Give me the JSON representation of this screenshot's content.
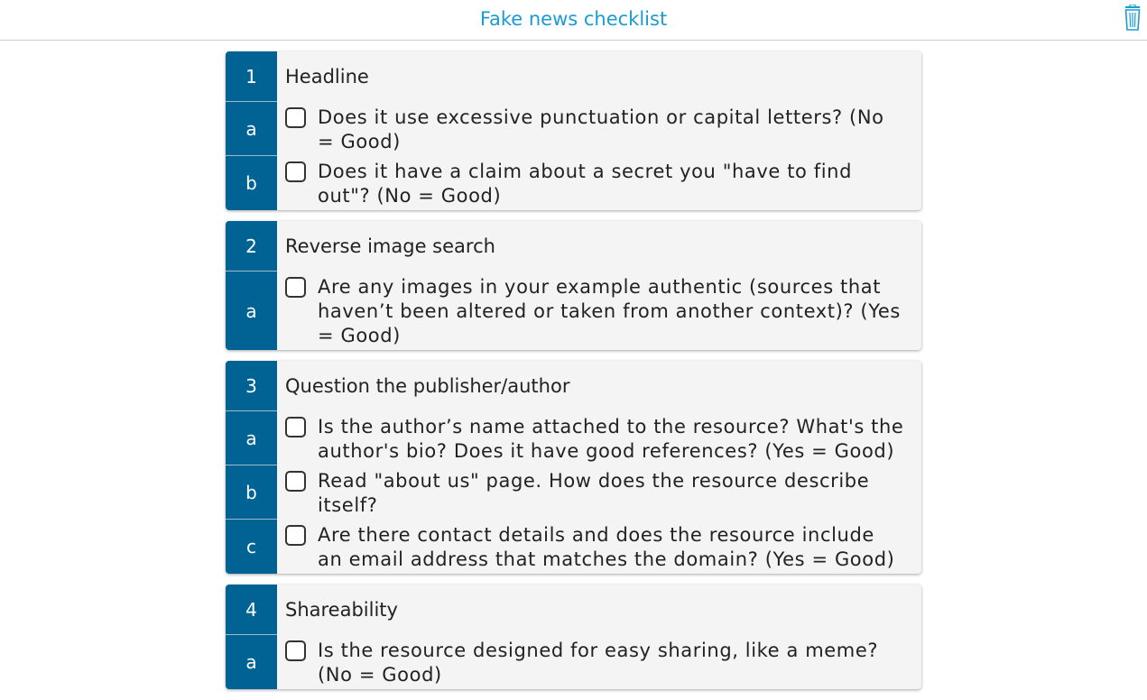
{
  "header": {
    "title": "Fake news checklist"
  },
  "sections": [
    {
      "number": "1",
      "title": "Headline",
      "items": [
        {
          "letter": "a",
          "text": "Does it use excessive punctuation or capital letters? (No = Good)"
        },
        {
          "letter": "b",
          "text": "Does it have a claim about a secret you \"have to find out\"? (No = Good)"
        }
      ]
    },
    {
      "number": "2",
      "title": "Reverse image search",
      "items": [
        {
          "letter": "a",
          "text": "Are any images in your example authentic (sources that haven’t been altered or taken from another context)? (Yes = Good)"
        }
      ]
    },
    {
      "number": "3",
      "title": "Question the publisher/author",
      "items": [
        {
          "letter": "a",
          "text": "Is the author’s name attached to the resource? What's the author's bio? Does it have good references? (Yes = Good)"
        },
        {
          "letter": "b",
          "text": "Read \"about us\" page. How does the resource describe itself?"
        },
        {
          "letter": "c",
          "text": "Are there contact details and does the resource include an email address that matches the domain? (Yes = Good)"
        }
      ]
    },
    {
      "number": "4",
      "title": "Shareability",
      "items": [
        {
          "letter": "a",
          "text": "Is the resource designed for easy sharing, like a meme? (No = Good)"
        }
      ]
    }
  ],
  "colors": {
    "accent": "#1b9bd4",
    "badge": "#006394",
    "card": "#f4f4f4"
  },
  "icons": {
    "trash": "trash-icon",
    "checkbox": "checkbox-unchecked"
  }
}
